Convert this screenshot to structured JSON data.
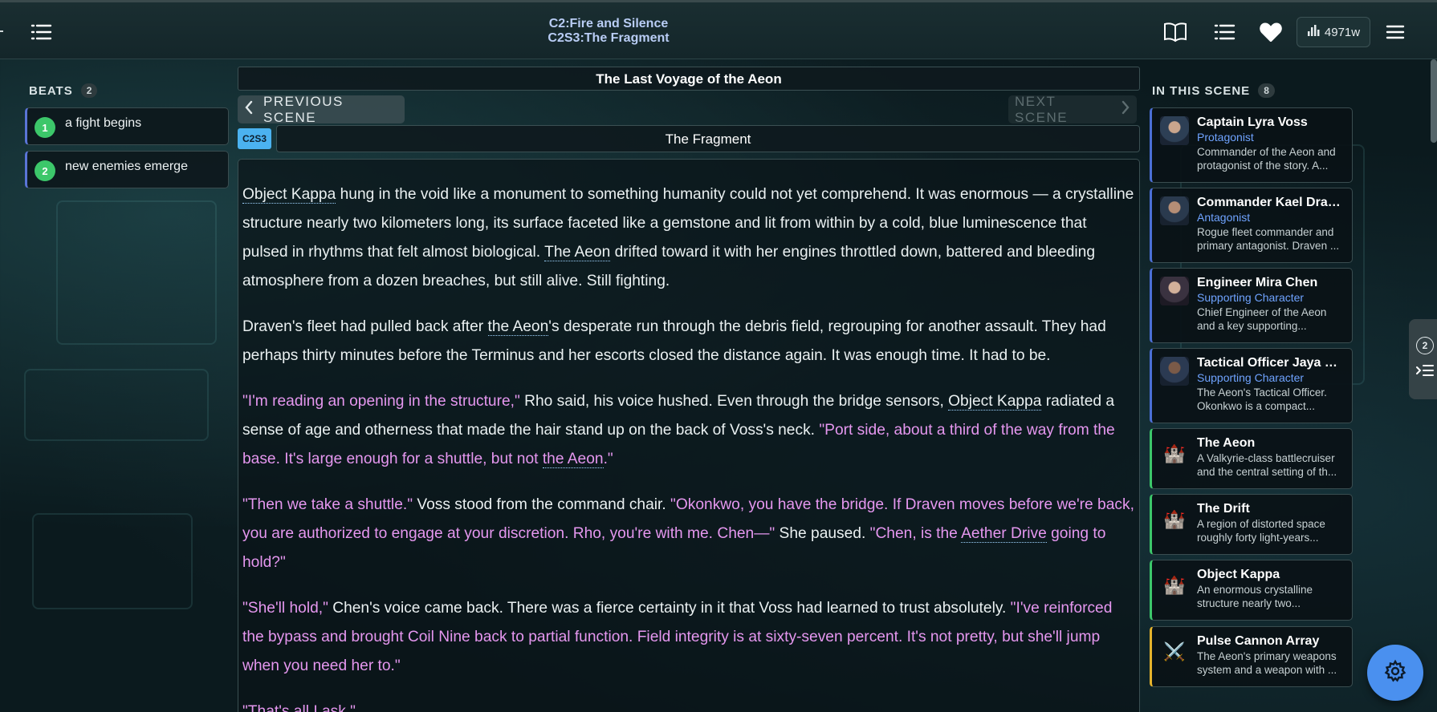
{
  "header": {
    "chapter": "C2:Fire and Silence",
    "scene": "C2S3:The Fragment",
    "word_count": "4971w"
  },
  "beats": {
    "heading": "BEATS",
    "count": "2",
    "items": [
      {
        "num": "1",
        "label": "a fight begins"
      },
      {
        "num": "2",
        "label": "new enemies emerge"
      }
    ]
  },
  "main": {
    "story_title": "The Last Voyage of the Aeon",
    "prev_label": "PREVIOUS SCENE",
    "next_label": "NEXT SCENE",
    "scene_tag": "C2S3",
    "scene_title": "The Fragment",
    "paragraphs": [
      {
        "segments": [
          {
            "t": "Object Kappa",
            "s": "entity"
          },
          {
            "t": " hung in the void like a monument to something humanity could not yet comprehend. It was enormous — a crystalline structure nearly two kilometers long, its surface faceted like a gemstone and lit from within by a cold, blue luminescence that pulsed in rhythms that felt almost biological. ",
            "s": "narration"
          },
          {
            "t": "The Aeon",
            "s": "entity"
          },
          {
            "t": " drifted toward it with her engines throttled down, battered and bleeding atmosphere from a dozen breaches, but still alive. Still fighting.",
            "s": "narration"
          }
        ]
      },
      {
        "segments": [
          {
            "t": "Draven's fleet had pulled back after ",
            "s": "narration"
          },
          {
            "t": "the Aeon",
            "s": "entity"
          },
          {
            "t": "'s desperate run through the debris field, regrouping for another assault. They had perhaps thirty minutes before the Terminus and her escorts closed the distance again. It was enough time. It had to be.",
            "s": "narration"
          }
        ]
      },
      {
        "segments": [
          {
            "t": "\"I'm reading an opening in the structure,\"",
            "s": "dialogue"
          },
          {
            "t": " Rho said, his voice hushed. Even through the bridge sensors, ",
            "s": "narration"
          },
          {
            "t": "Object Kappa",
            "s": "entity"
          },
          {
            "t": " radiated a sense of age and otherness that made the hair stand up on the back of Voss's neck. ",
            "s": "narration"
          },
          {
            "t": "\"Port side, about a third of the way from the base. It's large enough for a shuttle, but not ",
            "s": "dialogue"
          },
          {
            "t": "the Aeon",
            "s": "dialogue-entity"
          },
          {
            "t": ".\"",
            "s": "dialogue"
          }
        ]
      },
      {
        "segments": [
          {
            "t": "\"Then we take a shuttle.\"",
            "s": "dialogue"
          },
          {
            "t": " Voss stood from the command chair. ",
            "s": "narration"
          },
          {
            "t": "\"Okonkwo, you have the bridge. If Draven moves before we're back, you are authorized to engage at your discretion. Rho, you're with me. Chen—\"",
            "s": "dialogue"
          },
          {
            "t": " She paused. ",
            "s": "narration"
          },
          {
            "t": "\"Chen, is the ",
            "s": "dialogue"
          },
          {
            "t": "Aether Drive",
            "s": "dialogue-entity"
          },
          {
            "t": " going to hold?\"",
            "s": "dialogue"
          }
        ]
      },
      {
        "segments": [
          {
            "t": "\"She'll hold,\"",
            "s": "dialogue"
          },
          {
            "t": " Chen's voice came back. There was a fierce certainty in it that Voss had learned to trust absolutely. ",
            "s": "narration"
          },
          {
            "t": "\"I've reinforced the bypass and brought Coil Nine back to partial function. Field integrity is at sixty-seven percent. It's not pretty, but she'll jump when you need her to.\"",
            "s": "dialogue"
          }
        ]
      },
      {
        "segments": [
          {
            "t": "\"That's all I ask.\"",
            "s": "dialogue"
          }
        ]
      }
    ]
  },
  "scene_panel": {
    "heading": "IN THIS SCENE",
    "count": "8",
    "entities": [
      {
        "kind": "character",
        "name": "Captain Lyra Voss",
        "role": "Protagonist",
        "desc": "Commander of the Aeon and protagonist of the story. A..."
      },
      {
        "kind": "character",
        "name": "Commander Kael Draven",
        "role": "Antagonist",
        "desc": "Rogue fleet commander and primary antagonist. Draven ..."
      },
      {
        "kind": "character",
        "name": "Engineer Mira Chen",
        "role": "Supporting Character",
        "desc": "Chief Engineer of the Aeon and a key supporting..."
      },
      {
        "kind": "character",
        "name": "Tactical Officer Jaya Okonkwo",
        "role": "Supporting Character",
        "desc": "The Aeon's Tactical Officer. Okonkwo is a compact..."
      },
      {
        "kind": "location",
        "name": "The Aeon",
        "role": "",
        "desc": "A Valkyrie-class battlecruiser and the central setting of th..."
      },
      {
        "kind": "location",
        "name": "The Drift",
        "role": "",
        "desc": "A region of distorted space roughly forty light-years..."
      },
      {
        "kind": "location",
        "name": "Object Kappa",
        "role": "",
        "desc": "An enormous crystalline structure nearly two..."
      },
      {
        "kind": "item",
        "name": "Pulse Cannon Array",
        "role": "",
        "desc": "The Aeon's primary weapons system and a weapon with ..."
      }
    ]
  },
  "side_tab": {
    "count": "2"
  },
  "icons": {
    "menu": "list-icon",
    "book": "book-icon",
    "outline": "outline-list-icon",
    "favorite": "heart-icon",
    "stats": "bar-chart-icon",
    "hamburger": "hamburger-icon",
    "settings": "gear-icon",
    "location": "castle-icon",
    "item": "swords-icon"
  },
  "colors": {
    "accent": "#4a90ef",
    "dialogue": "#e597ef",
    "character_border": "#4b6fd6",
    "location_border": "#3cc76a",
    "item_border": "#e5b32c",
    "role": "#6fa3ff"
  }
}
